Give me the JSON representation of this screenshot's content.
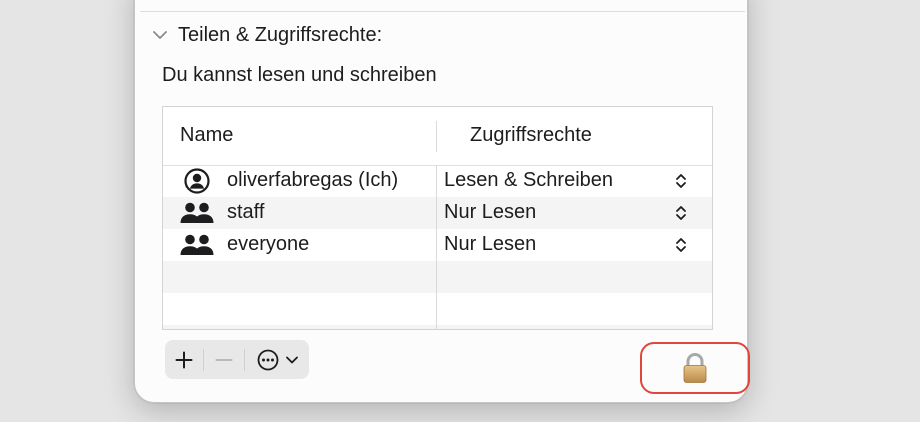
{
  "section": {
    "title": "Teilen & Zugriffsrechte:",
    "expanded": true,
    "description": "Du kannst lesen und schreiben"
  },
  "table": {
    "columns": {
      "name": "Name",
      "access": "Zugriffsrechte"
    },
    "rows": [
      {
        "icon": "user-circle-icon",
        "name": "oliverfabregas (Ich)",
        "access": "Lesen & Schreiben"
      },
      {
        "icon": "group-icon",
        "name": "staff",
        "access": "Nur Lesen"
      },
      {
        "icon": "group-icon",
        "name": "everyone",
        "access": "Nur Lesen"
      }
    ],
    "empty_rows": 2
  },
  "toolbar": {
    "add_icon": "plus-icon",
    "remove_icon": "minus-icon",
    "remove_enabled": false,
    "action_icon": "ellipsis-circle-icon",
    "dropdown_icon": "chevron-down-icon"
  },
  "lock": {
    "icon": "padlock-icon",
    "locked": true,
    "highlighted": true,
    "highlight_color": "#e0473b"
  }
}
